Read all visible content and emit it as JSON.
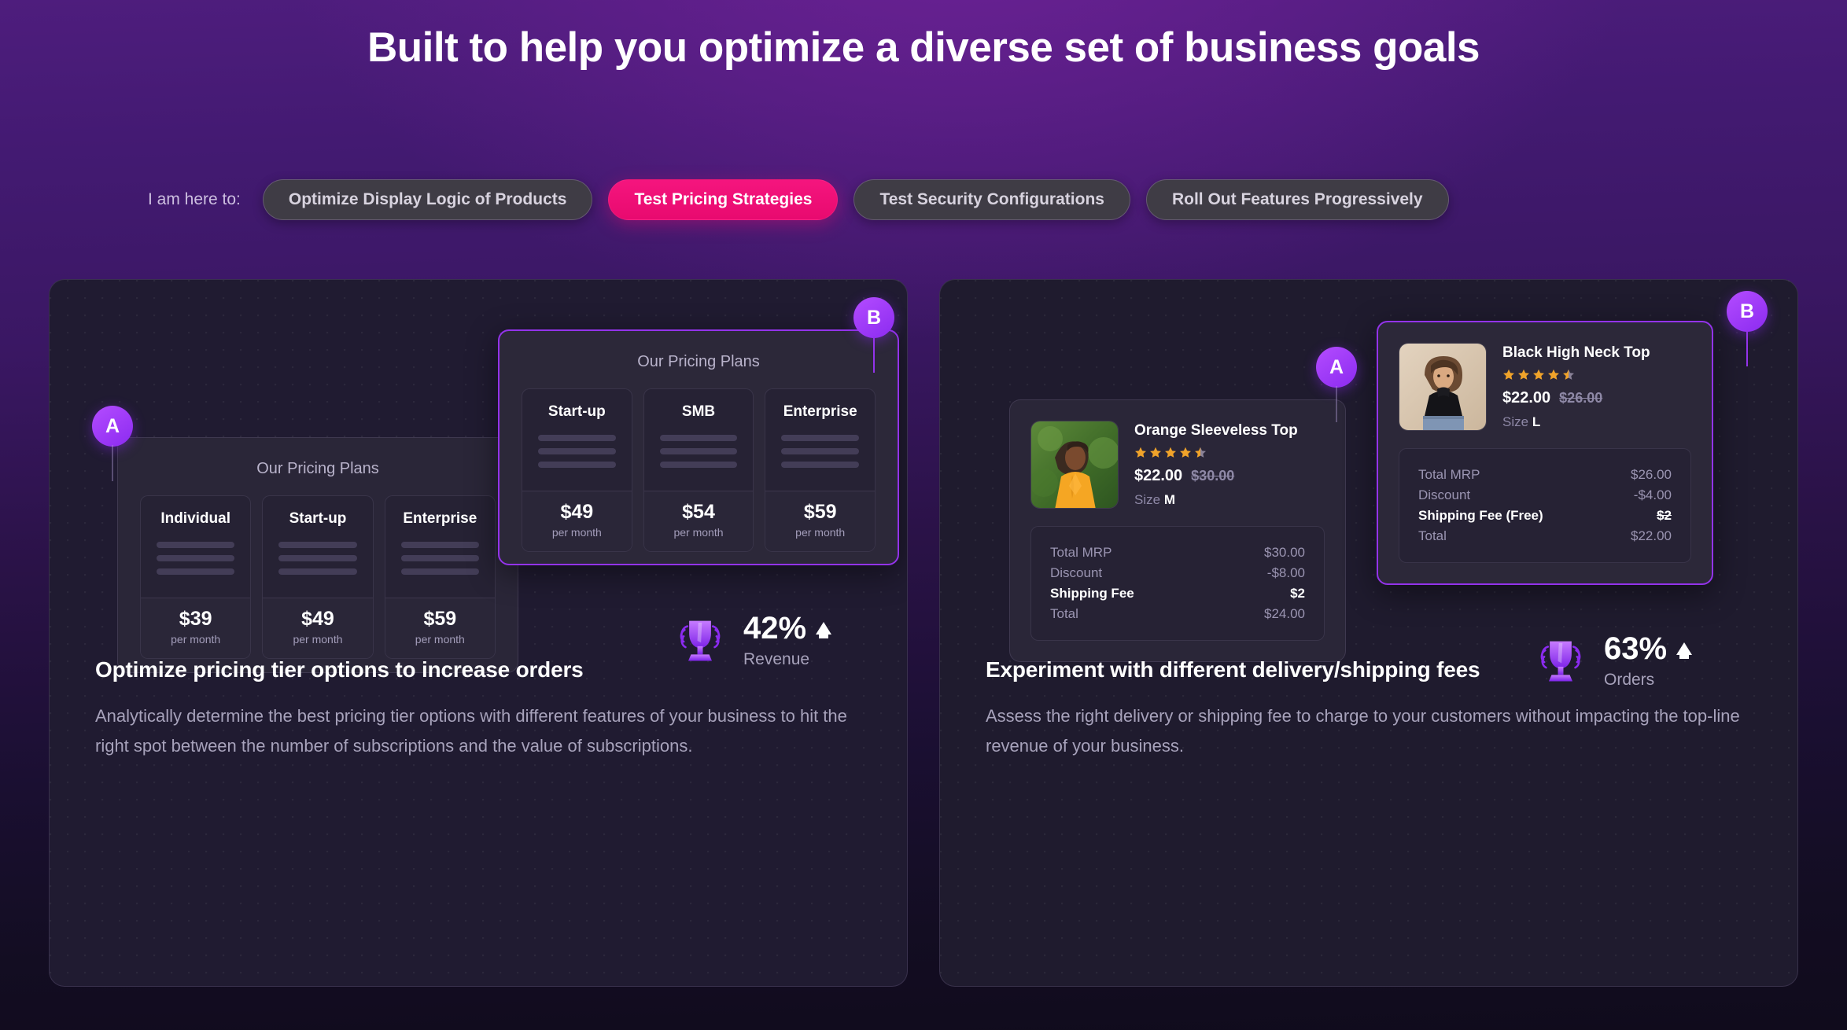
{
  "header": {
    "title": "Built to help you optimize a diverse set of business goals"
  },
  "tabs": {
    "prefix": "I am here to:",
    "items": [
      {
        "label": "Optimize Display Logic of Products",
        "active": false
      },
      {
        "label": "Test Pricing Strategies",
        "active": true
      },
      {
        "label": "Test Security Configurations",
        "active": false
      },
      {
        "label": "Roll Out Features Progressively",
        "active": false
      }
    ]
  },
  "colors": {
    "accent_pink": "#f5157e",
    "accent_purple": "#9333ea",
    "badge_gradient_from": "#b44cff",
    "badge_gradient_to": "#8b2bf0",
    "star_gold": "#f0a32a"
  },
  "left_card": {
    "badge_a": "A",
    "badge_b": "B",
    "panel_a": {
      "title": "Our Pricing Plans",
      "plans": [
        {
          "name": "Individual",
          "price": "$39",
          "per": "per month"
        },
        {
          "name": "Start-up",
          "price": "$49",
          "per": "per month"
        },
        {
          "name": "Enterprise",
          "price": "$59",
          "per": "per month"
        }
      ]
    },
    "panel_b": {
      "title": "Our Pricing Plans",
      "plans": [
        {
          "name": "Start-up",
          "price": "$49",
          "per": "per month"
        },
        {
          "name": "SMB",
          "price": "$54",
          "per": "per month"
        },
        {
          "name": "Enterprise",
          "price": "$59",
          "per": "per month"
        }
      ]
    },
    "metric": {
      "value": "42%",
      "label": "Revenue",
      "icon": "trophy-icon",
      "direction": "up"
    },
    "heading": "Optimize pricing tier options to increase orders",
    "body": "Analytically determine the best pricing tier options with different features of your business to hit the right spot between the number of subscriptions and the value of subscriptions."
  },
  "right_card": {
    "badge_a": "A",
    "badge_b": "B",
    "product_a": {
      "name": "Orange Sleeveless Top",
      "rating": 4.5,
      "price_new": "$22.00",
      "price_old": "$30.00",
      "size_label": "Size",
      "size_value": "M",
      "bill": [
        {
          "label": "Total MRP",
          "value": "$30.00",
          "emphasis": false,
          "strike": false
        },
        {
          "label": "Discount",
          "value": "-$8.00",
          "emphasis": false,
          "strike": false
        },
        {
          "label": "Shipping Fee",
          "value": "$2",
          "emphasis": true,
          "strike": false
        },
        {
          "label": "Total",
          "value": "$24.00",
          "emphasis": false,
          "strike": false
        }
      ]
    },
    "product_b": {
      "name": "Black High Neck Top",
      "rating": 4.5,
      "price_new": "$22.00",
      "price_old": "$26.00",
      "size_label": "Size",
      "size_value": "L",
      "bill": [
        {
          "label": "Total MRP",
          "value": "$26.00",
          "emphasis": false,
          "strike": false
        },
        {
          "label": "Discount",
          "value": "-$4.00",
          "emphasis": false,
          "strike": false
        },
        {
          "label": "Shipping Fee (Free)",
          "value": "$2",
          "emphasis": true,
          "strike": true
        },
        {
          "label": "Total",
          "value": "$22.00",
          "emphasis": false,
          "strike": false
        }
      ]
    },
    "metric": {
      "value": "63%",
      "label": "Orders",
      "icon": "trophy-icon",
      "direction": "up"
    },
    "heading": "Experiment with different delivery/shipping fees",
    "body": "Assess the right delivery or shipping fee to charge to your customers without impacting the top-line revenue of your business."
  }
}
